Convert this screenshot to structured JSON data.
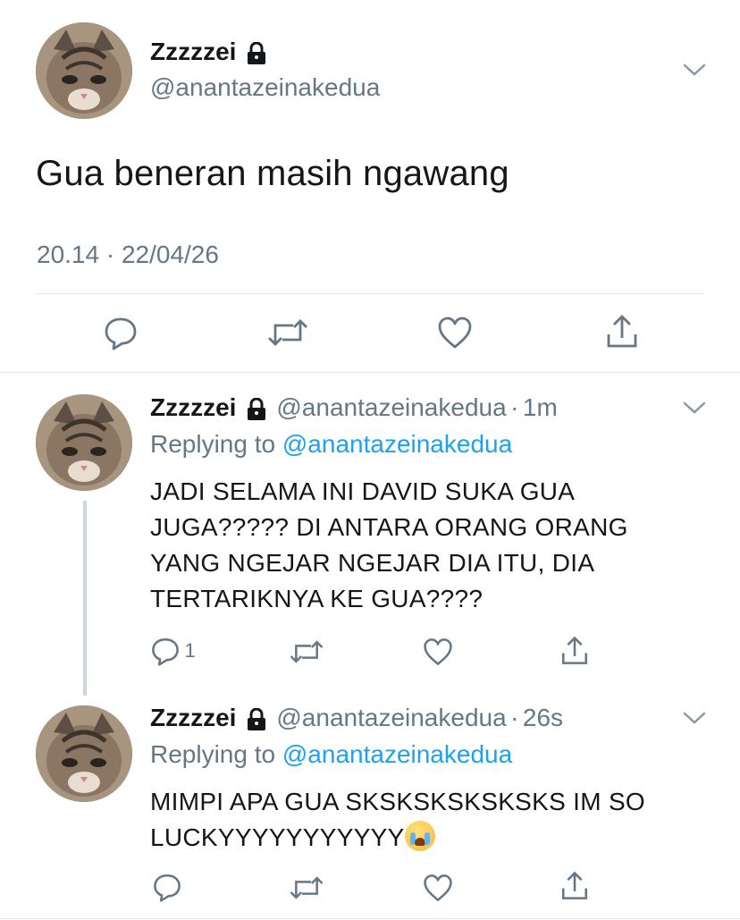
{
  "main_tweet": {
    "display_name": "Zzzzzei",
    "handle": "@anantazeinakedua",
    "text": "Gua beneran masih ngawang",
    "timestamp": "20.14 · 22/04/26",
    "icons": [
      "reply-icon",
      "retweet-icon",
      "like-icon",
      "share-icon"
    ]
  },
  "replies": [
    {
      "display_name": "Zzzzzei",
      "handle": "@anantazeinakedua",
      "separator": "·",
      "time": "1m",
      "replying_prefix": "Replying to",
      "replying_to": "@anantazeinakedua",
      "lines": [
        "JADI SELAMA INI DAVID SUKA GUA",
        "JUGA????? DI ANTARA ORANG ORANG",
        "YANG NGEJAR NGEJAR DIA ITU, DIA",
        "TERTARIKNYA KE GUA????"
      ],
      "reply_count": "1"
    },
    {
      "display_name": "Zzzzzei",
      "handle": "@anantazeinakedua",
      "separator": "·",
      "time": "26s",
      "replying_prefix": "Replying to",
      "replying_to": "@anantazeinakedua",
      "lines": [
        "MIMPI APA GUA SKSKSKSKSKSKS IM SO",
        "LUCKYYYYYYYYYYY"
      ],
      "emoji": "loudly-crying-face",
      "reply_count": ""
    }
  ],
  "colors": {
    "text": "#14171a",
    "secondary": "#657786",
    "link": "#1da1f2",
    "divider": "#e1e8ed"
  }
}
